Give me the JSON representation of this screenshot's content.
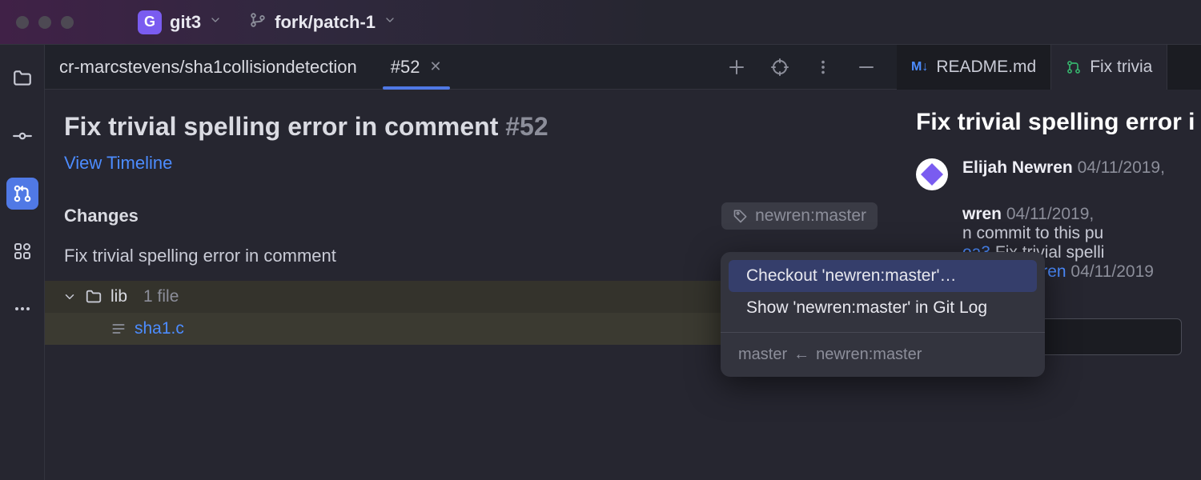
{
  "titlebar": {
    "app_badge": "G",
    "project": "git3",
    "branch": "fork/patch-1"
  },
  "tabbar": {
    "breadcrumb": "cr-marcstevens/sha1collisiondetection",
    "tab_label": "#52"
  },
  "pr": {
    "title": "Fix trivial spelling error in comment",
    "number": "#52",
    "view_timeline": "View Timeline",
    "changes_heading": "Changes",
    "branch_tag": "newren:master",
    "commit_msg": "Fix trivial spelling error in comment"
  },
  "files": {
    "folder": "lib",
    "folder_count": "1 file",
    "file": "sha1.c"
  },
  "menu": {
    "items": [
      "Checkout 'newren:master'…",
      "Show 'newren:master' in Git Log"
    ],
    "footer_target": "master",
    "footer_source": "newren:master"
  },
  "rightpanel": {
    "tabs": {
      "readme": "README.md",
      "pr": "Fix trivia"
    },
    "title": "Fix trivial spelling error i",
    "events": [
      {
        "author": "Elijah Newren",
        "date": "04/11/2019,"
      },
      {
        "author_suffix": "wren",
        "date": "04/11/2019,",
        "line2": "n commit to this pu",
        "hash": "oa3",
        "msg": "Fix trivial spelli",
        "author2": "Elijah Newren",
        "date2": "04/11/2019"
      }
    ]
  }
}
